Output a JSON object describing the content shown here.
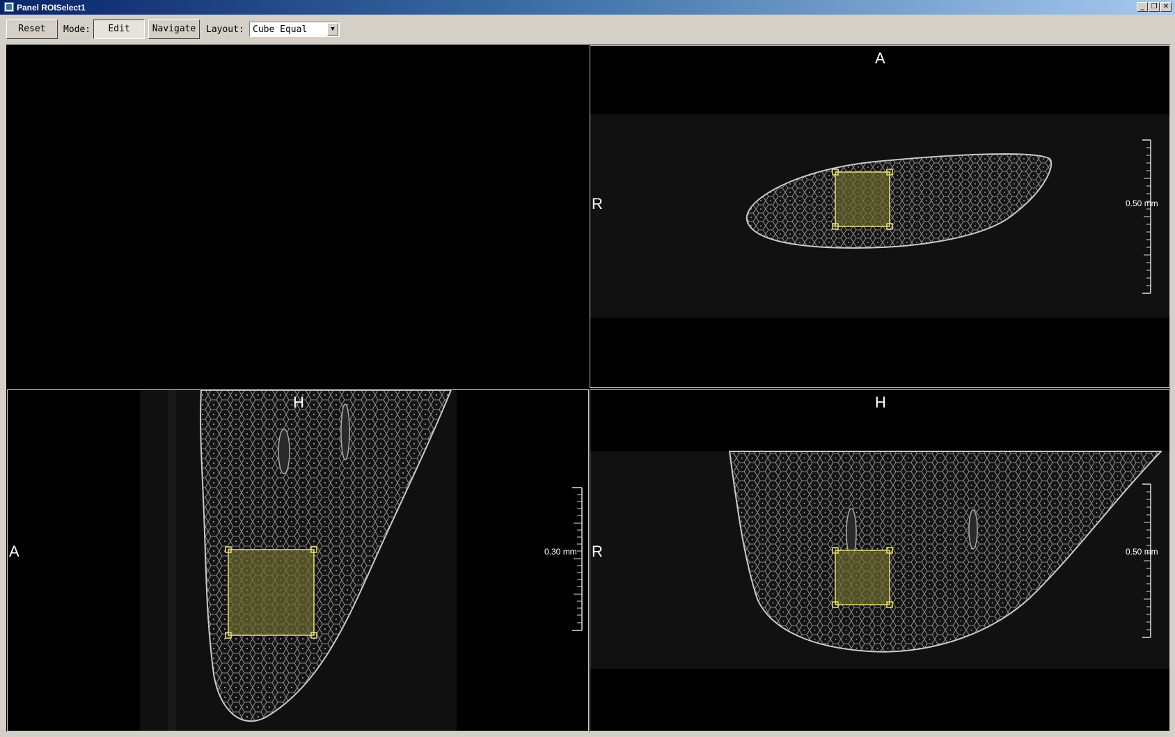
{
  "window": {
    "title": "Panel ROISelect1",
    "minimize_symbol": "_",
    "restore_symbol": "❐",
    "close_symbol": "✕"
  },
  "toolbar": {
    "reset_label": "Reset",
    "mode_label": "Mode:",
    "edit_label": "Edit",
    "navigate_label": "Navigate",
    "layout_label": "Layout:",
    "layout_value": "Cube Equal",
    "dropdown_arrow": "▼"
  },
  "views": {
    "top_right": {
      "top": "A",
      "left": "R",
      "scale": "0.50 mm"
    },
    "bottom_left": {
      "top": "H",
      "left": "A",
      "scale": "0.30 mm"
    },
    "bottom_right": {
      "top": "H",
      "left": "R",
      "scale": "0.50 mm"
    }
  },
  "colors": {
    "roi_stroke": "#e8e07a",
    "roi_fill": "#6b6a2e",
    "tissue": "#a8a8a8",
    "background": "#000000"
  }
}
